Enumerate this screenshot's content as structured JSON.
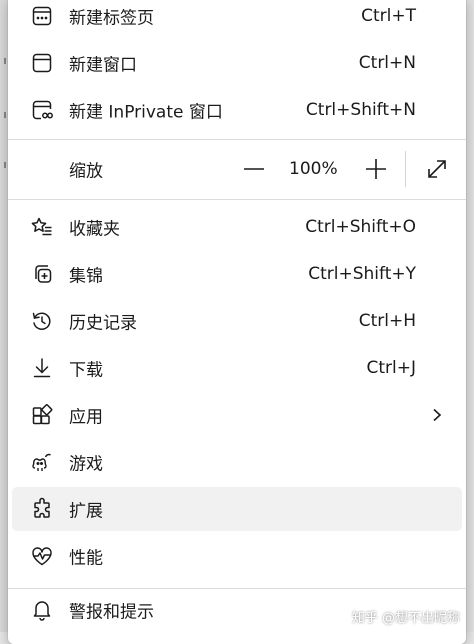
{
  "menu": {
    "new_tab": {
      "label": "新建标签页",
      "shortcut": "Ctrl+T",
      "icon": "new-tab-icon"
    },
    "new_window": {
      "label": "新建窗口",
      "shortcut": "Ctrl+N",
      "icon": "new-window-icon"
    },
    "new_inprivate": {
      "label": "新建 InPrivate 窗口",
      "shortcut": "Ctrl+Shift+N",
      "icon": "inprivate-window-icon"
    },
    "zoom": {
      "label": "缩放",
      "minus": "—",
      "value": "100%",
      "plus": "+",
      "icon": "fullscreen-icon"
    },
    "favorites": {
      "label": "收藏夹",
      "shortcut": "Ctrl+Shift+O",
      "icon": "favorites-icon"
    },
    "collections": {
      "label": "集锦",
      "shortcut": "Ctrl+Shift+Y",
      "icon": "collections-icon"
    },
    "history": {
      "label": "历史记录",
      "shortcut": "Ctrl+H",
      "icon": "history-icon"
    },
    "downloads": {
      "label": "下载",
      "shortcut": "Ctrl+J",
      "icon": "download-icon"
    },
    "apps": {
      "label": "应用",
      "icon": "apps-icon",
      "submenu_icon": "chevron-right-icon"
    },
    "games": {
      "label": "游戏",
      "icon": "games-icon"
    },
    "extensions": {
      "label": "扩展",
      "icon": "extensions-icon"
    },
    "performance": {
      "label": "性能",
      "icon": "performance-icon"
    },
    "alerts": {
      "label": "警报和提示",
      "icon": "bell-icon"
    }
  },
  "watermark": "知乎 @想不出昵称",
  "colors": {
    "menu_bg": "#ffffff",
    "hover_bg": "#f1f1f1",
    "divider": "#dcdcdc",
    "text": "#1b1b1b"
  }
}
